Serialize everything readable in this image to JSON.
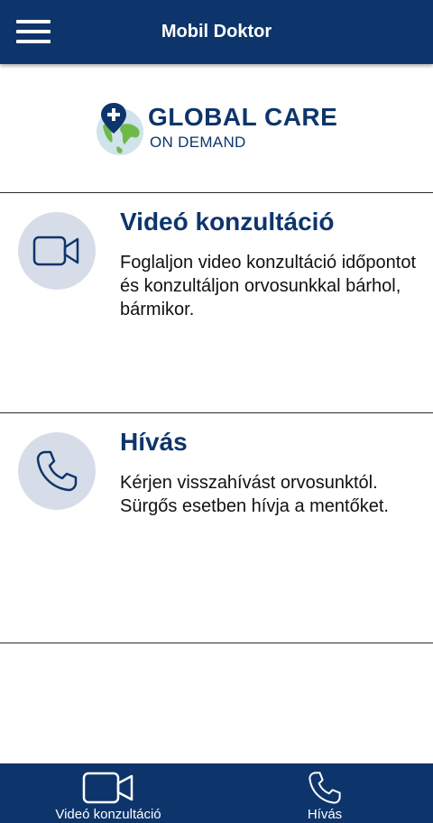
{
  "header": {
    "title": "Mobil Doktor",
    "menu_icon": "hamburger-menu-icon"
  },
  "logo": {
    "line1": "GLOBAL CARE",
    "line2": "ON DEMAND"
  },
  "cards": [
    {
      "title": "Videó konzultáció",
      "description": "Foglaljon video konzultáció időpontot és konzultáljon orvosunkkal bárhol, bármikor.",
      "icon": "video-camera-icon"
    },
    {
      "title": "Hívás",
      "description": "Kérjen visszahívást orvosunktól. Sürgős esetben hívja a mentőket.",
      "icon": "phone-icon"
    }
  ],
  "bottom_nav": {
    "items": [
      {
        "label": "Videó konzultáció",
        "icon": "video-camera-icon"
      },
      {
        "label": "Hívás",
        "icon": "phone-icon"
      }
    ]
  },
  "colors": {
    "primary": "#0e356b",
    "icon_circle": "#d6dde8",
    "globe_water": "#cfe3ea",
    "globe_land": "#6fb84a"
  }
}
